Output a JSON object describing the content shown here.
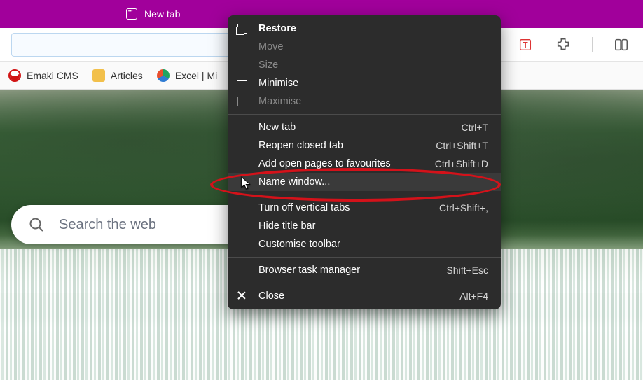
{
  "titlebar": {
    "tab_label": "New tab"
  },
  "toolbar": {
    "icons": [
      "t-extension-icon",
      "extensions-icon",
      "split-screen-icon"
    ]
  },
  "bookmarks": [
    {
      "label": "Emaki CMS",
      "color": "#d11414",
      "name": "bookmark-emaki"
    },
    {
      "label": "Articles",
      "color": "#f2c04b",
      "name": "bookmark-articles"
    },
    {
      "label": "Excel | Mi",
      "color": "#1fa463",
      "name": "bookmark-excel"
    }
  ],
  "search": {
    "placeholder": "Search the web"
  },
  "menu": {
    "groups": [
      [
        {
          "label": "Restore",
          "shortcut": "",
          "icon": "restore",
          "bold": true,
          "disabled": false
        },
        {
          "label": "Move",
          "shortcut": "",
          "icon": "",
          "disabled": true
        },
        {
          "label": "Size",
          "shortcut": "",
          "icon": "",
          "disabled": true
        },
        {
          "label": "Minimise",
          "shortcut": "",
          "icon": "min",
          "disabled": false
        },
        {
          "label": "Maximise",
          "shortcut": "",
          "icon": "max",
          "disabled": true
        }
      ],
      [
        {
          "label": "New tab",
          "shortcut": "Ctrl+T",
          "disabled": false
        },
        {
          "label": "Reopen closed tab",
          "shortcut": "Ctrl+Shift+T",
          "disabled": false
        },
        {
          "label": "Add open pages to favourites",
          "shortcut": "Ctrl+Shift+D",
          "disabled": false
        },
        {
          "label": "Name window...",
          "shortcut": "",
          "disabled": false,
          "highlight": true
        }
      ],
      [
        {
          "label": "Turn off vertical tabs",
          "shortcut": "Ctrl+Shift+,",
          "disabled": false
        },
        {
          "label": "Hide title bar",
          "shortcut": "",
          "disabled": false
        },
        {
          "label": "Customise toolbar",
          "shortcut": "",
          "disabled": false
        }
      ],
      [
        {
          "label": "Browser task manager",
          "shortcut": "Shift+Esc",
          "disabled": false
        }
      ],
      [
        {
          "label": "Close",
          "shortcut": "Alt+F4",
          "icon": "close",
          "disabled": false
        }
      ]
    ]
  },
  "annotation": {
    "highlighted_item": "Name window..."
  }
}
